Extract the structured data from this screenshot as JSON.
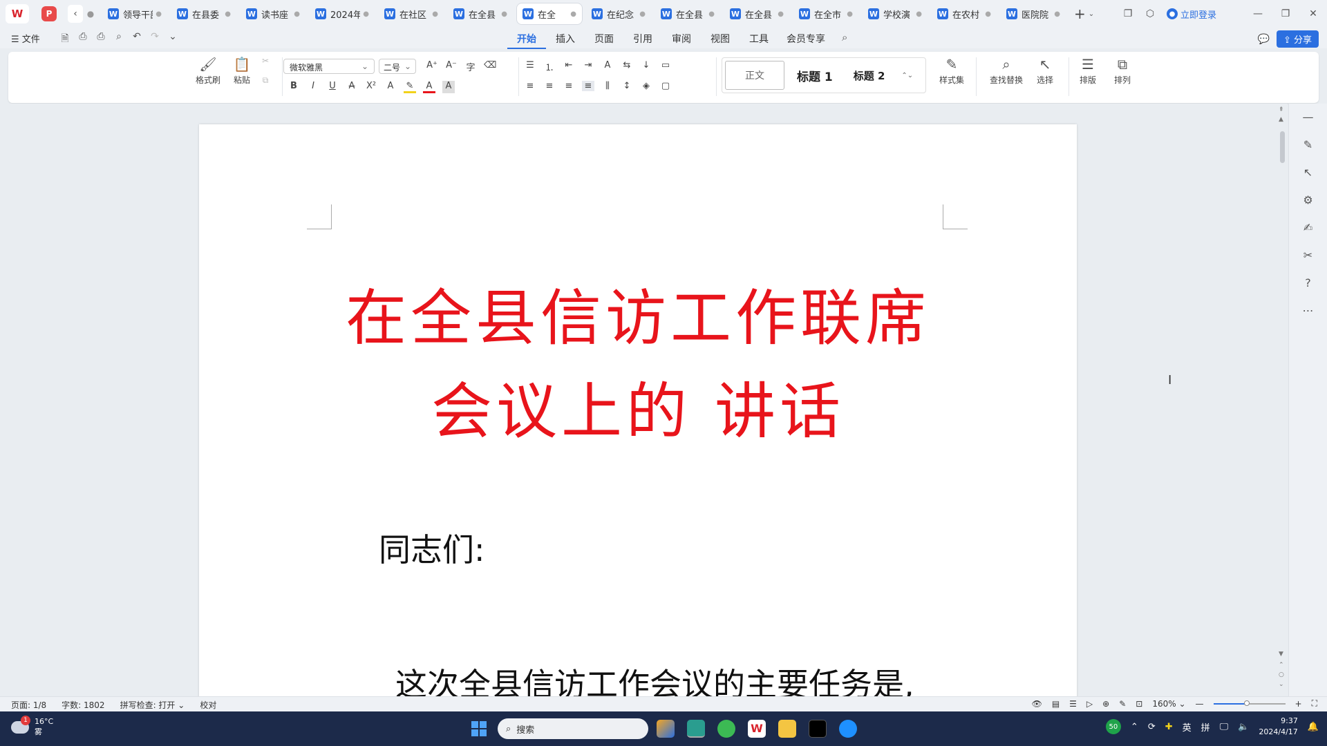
{
  "tabbar": {
    "wps_logo": "W",
    "pdf_logo": "P",
    "tabs": [
      {
        "label": "领导干部"
      },
      {
        "label": "在县委"
      },
      {
        "label": "读书座"
      },
      {
        "label": "2024年"
      },
      {
        "label": "在社区"
      },
      {
        "label": "在全县"
      },
      {
        "label": "在全"
      },
      {
        "label": "在纪念"
      },
      {
        "label": "在全县"
      },
      {
        "label": "在全县"
      },
      {
        "label": "在全市"
      },
      {
        "label": "学校演"
      },
      {
        "label": "在农村"
      },
      {
        "label": "医院院"
      }
    ],
    "login_label": "立即登录"
  },
  "menubar": {
    "file_label": "文件",
    "tabs": [
      "开始",
      "插入",
      "页面",
      "引用",
      "审阅",
      "视图",
      "工具",
      "会员专享"
    ],
    "share_label": "分享"
  },
  "ribbon": {
    "format_painter": "格式刷",
    "paste": "粘贴",
    "font_name": "微软雅黑",
    "font_size": "二号",
    "style_normal": "正文",
    "style_h1": "标题 1",
    "style_h2": "标题 2",
    "style_set": "样式集",
    "find_replace": "查找替换",
    "select": "选择",
    "layout": "排版",
    "arrange": "排列"
  },
  "document": {
    "title_line1": "在全县信访工作联席",
    "title_line2": "会议上的 讲话",
    "greeting": "同志们:",
    "paragraph": "这次全县信访工作会议的主要任务是,",
    "title_color": "#e8141b"
  },
  "statusbar": {
    "page": "页面: 1/8",
    "words": "字数: 1802",
    "spell": "拼写检查: 打开",
    "proof": "校对",
    "zoom": "160%",
    "zoom_level": 0.47
  },
  "taskbar": {
    "temperature": "16°C",
    "weather": "雾",
    "weather_badge": "1",
    "search_placeholder": "搜索",
    "tray_badge": "50",
    "ime_lang": "英",
    "ime_mode": "拼",
    "time": "9:37",
    "date": "2024/4/17"
  },
  "colors": {
    "accent": "#2b6fe0",
    "wps_red": "#d9232c"
  }
}
